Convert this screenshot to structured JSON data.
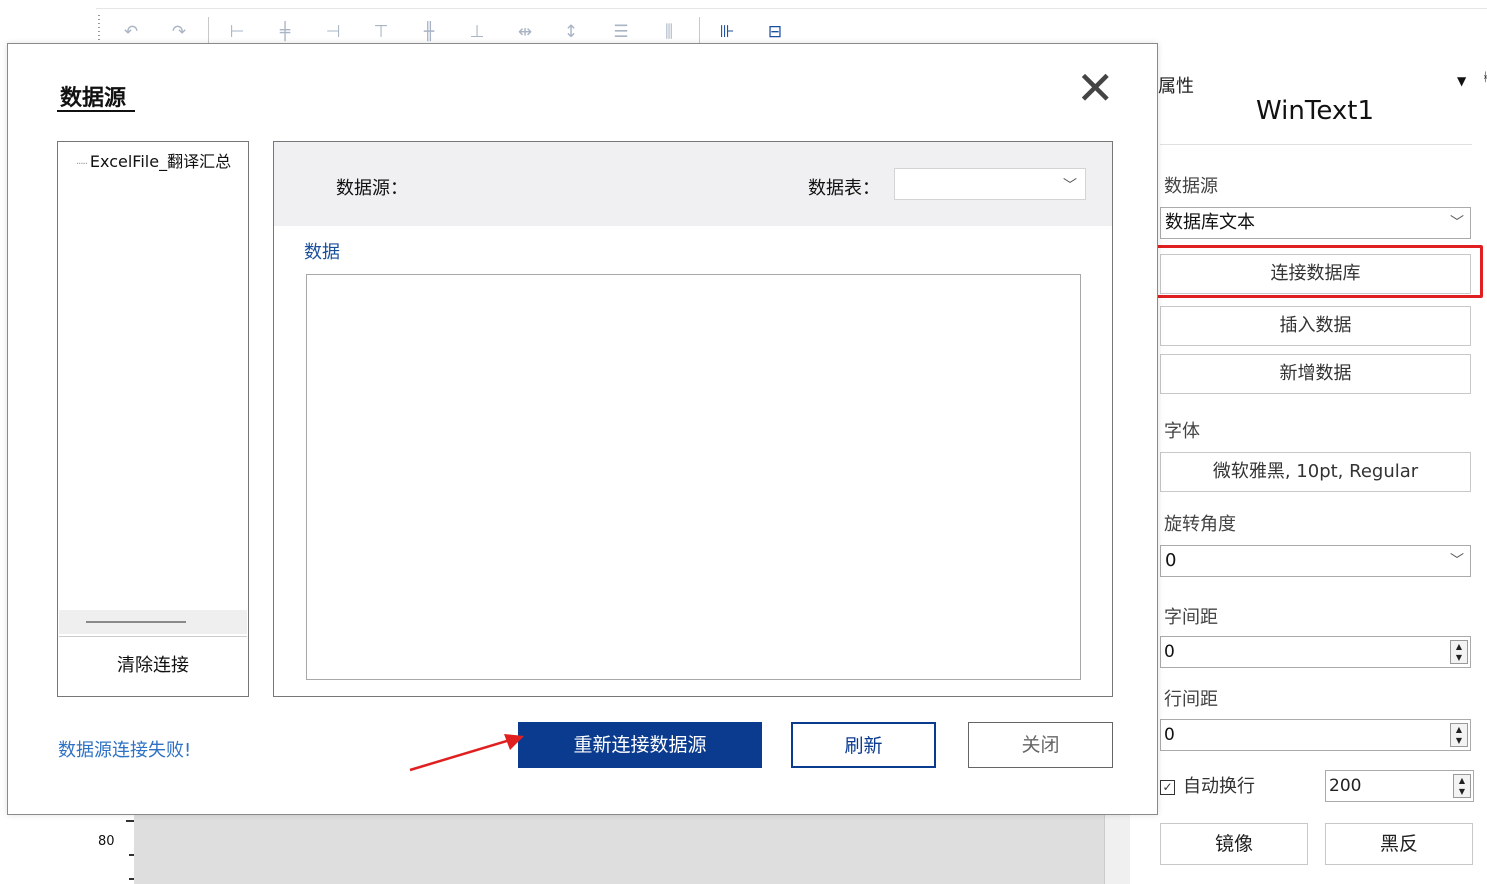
{
  "toolbar": {
    "icons": [
      "undo-icon",
      "redo-icon",
      "align-left-icon",
      "align-center-icon",
      "align-right-icon",
      "align-top-icon",
      "align-middle-icon",
      "align-bottom-icon",
      "same-width-icon",
      "same-height-icon",
      "vertical-spacing-icon",
      "horizontal-spacing-icon",
      "distribute-h-icon",
      "distribute-v-icon"
    ]
  },
  "ruler": {
    "label": "80"
  },
  "dialog": {
    "title": "数据源",
    "tree": {
      "item": "ExcelFile_翻译汇总",
      "clear_button": "清除连接"
    },
    "source_label": "数据源：",
    "table_label": "数据表：",
    "table_value": "",
    "data_label": "数据",
    "status": "数据源连接失败!",
    "buttons": {
      "reconnect": "重新连接数据源",
      "refresh": "刷新",
      "close": "关闭"
    },
    "annotation_color": "#e02020"
  },
  "properties": {
    "title": "属性",
    "object_name": "WinText1",
    "datasource_label": "数据源",
    "datasource_value": "数据库文本",
    "connect_button": "连接数据库",
    "insert_button": "插入数据",
    "add_button": "新增数据",
    "font_label": "字体",
    "font_value": "微软雅黑, 10pt, Regular",
    "rotation_label": "旋转角度",
    "rotation_value": "0",
    "char_spacing_label": "字间距",
    "char_spacing_value": "0",
    "line_spacing_label": "行间距",
    "line_spacing_value": "0",
    "autowrap_label": "自动换行",
    "autowrap_checked": true,
    "autowrap_value": "200",
    "mirror_button": "镜像",
    "invert_button": "黑反"
  },
  "colors": {
    "primary": "#0b3b8f",
    "link": "#2f72c5",
    "highlight": "#e02020"
  }
}
